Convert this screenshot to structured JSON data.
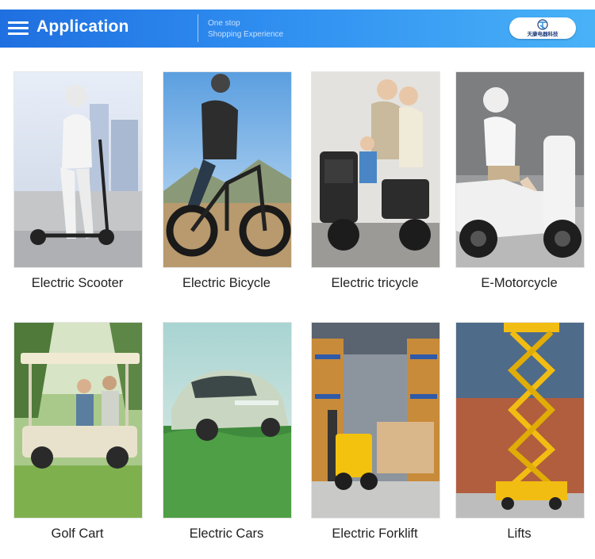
{
  "header": {
    "title": "Application",
    "slogan_line1": "One stop",
    "slogan_line2": "Shopping Experience",
    "logo_text": "天康电器科技"
  },
  "colors": {
    "header_start": "#1f6fe0",
    "header_end": "#49b2f7",
    "label_text": "#222222"
  },
  "products": [
    {
      "label": "Electric Scooter",
      "icon": "electric-scooter-photo"
    },
    {
      "label": "Electric Bicycle",
      "icon": "electric-bicycle-photo"
    },
    {
      "label": "Electric tricycle",
      "icon": "electric-tricycle-photo"
    },
    {
      "label": "E-Motorcycle",
      "icon": "e-motorcycle-photo"
    },
    {
      "label": "Golf Cart",
      "icon": "golf-cart-photo"
    },
    {
      "label": "Electric Cars",
      "icon": "electric-car-photo"
    },
    {
      "label": "Electric Forklift",
      "icon": "electric-forklift-photo"
    },
    {
      "label": "Lifts",
      "icon": "scissor-lift-photo"
    }
  ]
}
